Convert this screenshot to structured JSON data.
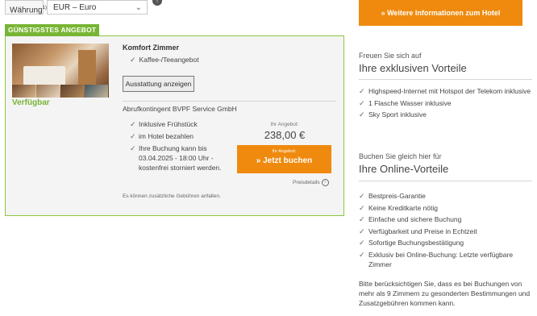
{
  "currency": {
    "label": "Währung",
    "label_sup": "1)",
    "selected": "EUR – Euro",
    "info_icon": "info-icon"
  },
  "offer": {
    "badge": "GÜNSTIGSTES ANGEBOT",
    "availability": "Verfügbar",
    "room_title": "Komfort Zimmer",
    "room_features": [
      "Kaffee-/Teeangebot"
    ],
    "amenities_button": "Ausstattung anzeigen",
    "quota": "Abrufkontingent BVPF Service GmbH",
    "conditions": [
      "Inklusive Frühstück",
      "im Hotel bezahlen",
      "Ihre Buchung kann bis 03.04.2025 - 18:00 Uhr - kostenfrei storniert werden."
    ],
    "price_label": "Ihr Angebot:",
    "price": "238,00 €",
    "book_small": "Ihr Angebot:",
    "book_label": "» Jetzt buchen",
    "price_details": "Preisdetails",
    "fees_note": "Es können zusätzliche Gebühren anfallen."
  },
  "sidebar": {
    "more_info_button": "» Weitere Informationen zum Hotel",
    "exclusive": {
      "subtitle": "Freuen Sie sich auf",
      "title": "Ihre exklusiven Vorteile",
      "items": [
        "Highspeed-Internet mit Hotspot der Telekom inklusive",
        "1 Flasche Wasser inklusive",
        "Sky Sport inklusive"
      ]
    },
    "online": {
      "subtitle": "Buchen Sie gleich hier für",
      "title": "Ihre Online-Vorteile",
      "items": [
        "Bestpreis-Garantie",
        "Keine Kreditkarte nötig",
        "Einfache und sichere Buchung",
        "Verfügbarkeit und Preise in Echtzeit",
        "Sofortige Buchungsbestätigung",
        "Exklusiv bei Online-Buchung: Letzte verfügbare Zimmer"
      ]
    },
    "note": "Bitte berücksichtigen Sie, dass es bei Buchungen von mehr als 9 Zimmern zu gesonderten Bestimmungen und Zusatzgebühren kommen kann."
  },
  "colors": {
    "accent_orange": "#ef8a0e",
    "accent_green": "#78b534",
    "card_border": "#8dc63f"
  }
}
